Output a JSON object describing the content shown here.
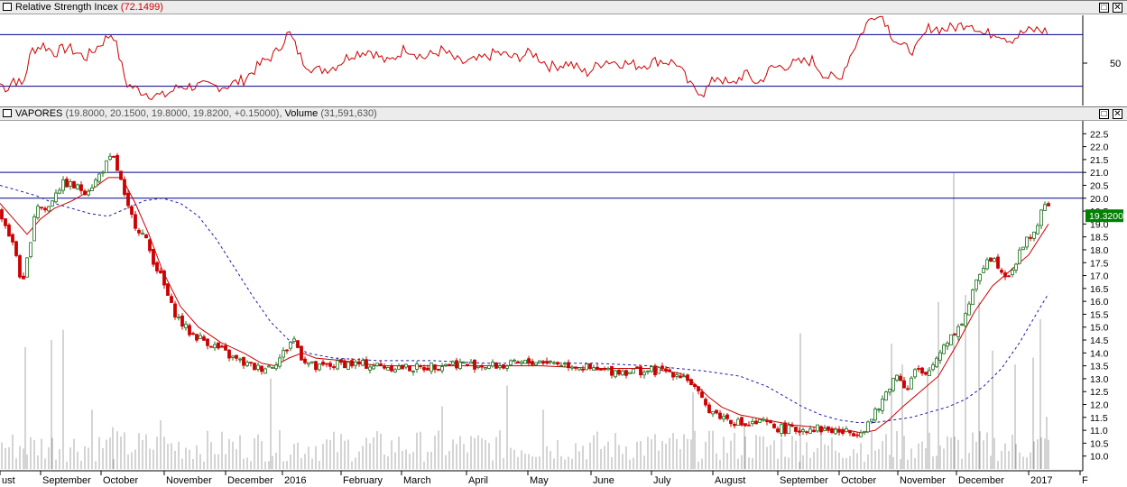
{
  "rsi_panel": {
    "title": "Relative Strength Incex",
    "value": "(72.1499)",
    "axis_label": "50",
    "buttons": [
      "□",
      "✕"
    ]
  },
  "price_panel": {
    "title": "VAPORES",
    "ohlc_text": "(19.8000, 20.1500, 19.8000, 19.8200, +0.15000),",
    "volume_title": "Volume",
    "volume_value": "(31,591,630)",
    "last_price": "19.3200",
    "buttons": [
      "□",
      "✕"
    ]
  },
  "colors": {
    "candle_up": "#1a6e1a",
    "candle_down": "#cc0000",
    "sma_short": "#cc0000",
    "sma_long": "#1a1aa8",
    "hline": "#00008b",
    "last_price_bg": "#008000"
  },
  "chart_data": [
    {
      "type": "line",
      "title": "Relative Strength Incex",
      "ylim": [
        15,
        85
      ],
      "hlines": [
        30,
        70
      ],
      "yticks": [
        "50"
      ],
      "series": [
        {
          "name": "Relative Strength Incex",
          "x": [
            0,
            8,
            15,
            25,
            35,
            48,
            60,
            75,
            95,
            110,
            125,
            140,
            150,
            165,
            180,
            200,
            215,
            230,
            250,
            270,
            290,
            305,
            320,
            335,
            350,
            370,
            390,
            410,
            430,
            450,
            470,
            490,
            510,
            530,
            550,
            570,
            590,
            610,
            630,
            650,
            670,
            690,
            710,
            730,
            750,
            765,
            780,
            795,
            810,
            825,
            840,
            855,
            870,
            885,
            900,
            915,
            930,
            945,
            960,
            975,
            988,
            1000,
            1015,
            1030,
            1045,
            1060,
            1075,
            1090,
            1105,
            1120,
            1135,
            1150,
            1162
          ],
          "values": [
            32,
            28,
            36,
            30,
            58,
            62,
            56,
            60,
            52,
            62,
            72,
            32,
            28,
            24,
            22,
            30,
            30,
            30,
            30,
            35,
            48,
            55,
            72,
            50,
            42,
            45,
            55,
            58,
            48,
            60,
            52,
            58,
            48,
            50,
            56,
            52,
            56,
            45,
            48,
            40,
            50,
            48,
            46,
            50,
            48,
            30,
            25,
            38,
            30,
            40,
            32,
            44,
            46,
            48,
            50,
            38,
            35,
            58,
            78,
            90,
            70,
            60,
            58,
            76,
            74,
            76,
            80,
            70,
            72,
            66,
            72,
            74,
            72
          ]
        }
      ]
    },
    {
      "type": "candlestick",
      "title": "VAPORES",
      "ylim": [
        9.5,
        23.0
      ],
      "yticks": [
        "10.0",
        "10.5",
        "11.0",
        "11.5",
        "12.0",
        "12.5",
        "13.0",
        "13.5",
        "14.0",
        "14.5",
        "15.0",
        "15.5",
        "16.0",
        "16.5",
        "17.0",
        "17.5",
        "18.0",
        "18.5",
        "19.0",
        "19.5",
        "20.0",
        "20.5",
        "21.0",
        "21.5",
        "22.0",
        "22.5"
      ],
      "hlines": [
        21.0,
        20.0
      ],
      "xticks": [
        "ust",
        "September",
        "October",
        "November",
        "December",
        "2016",
        "February",
        "March",
        "April",
        "May",
        "June",
        "July",
        "August",
        "September",
        "October",
        "November",
        "December",
        "2017",
        "F"
      ],
      "x_range": [
        0,
        1200
      ],
      "xtick_positions": [
        0,
        45,
        112,
        182,
        250,
        313,
        378,
        445,
        517,
        585,
        655,
        722,
        790,
        862,
        930,
        995,
        1060,
        1140,
        1197
      ],
      "close_anchors": {
        "x": [
          0,
          10,
          18,
          25,
          32,
          40,
          52,
          62,
          72,
          85,
          95,
          105,
          115,
          125,
          133,
          140,
          150,
          160,
          170,
          180,
          190,
          200,
          210,
          220,
          232,
          245,
          258,
          270,
          285,
          300,
          310,
          318,
          325,
          335,
          350,
          380,
          420,
          460,
          500,
          540,
          560,
          600,
          640,
          660,
          700,
          740,
          760,
          770,
          780,
          795,
          810,
          825,
          845,
          860,
          880,
          900,
          920,
          940,
          955,
          965,
          975,
          985,
          995,
          1005,
          1015,
          1025,
          1035,
          1045,
          1055,
          1065,
          1075,
          1085,
          1095,
          1105,
          1115,
          1125,
          1135,
          1145,
          1155,
          1162
        ],
        "values": [
          19.5,
          18.6,
          17.8,
          16.5,
          18.0,
          19.8,
          19.5,
          20.3,
          20.6,
          20.4,
          20.3,
          20.6,
          21.2,
          21.6,
          20.8,
          19.7,
          19.0,
          18.5,
          17.6,
          16.8,
          15.8,
          15.2,
          14.8,
          14.6,
          14.4,
          14.1,
          13.8,
          13.6,
          13.4,
          13.5,
          13.8,
          14.2,
          14.6,
          13.8,
          13.4,
          13.6,
          13.5,
          13.4,
          13.6,
          13.5,
          13.5,
          13.7,
          13.5,
          13.3,
          13.3,
          13.3,
          13.1,
          12.6,
          12.0,
          11.6,
          11.4,
          11.2,
          11.3,
          11.1,
          11.0,
          11.1,
          11.0,
          10.9,
          11.0,
          11.4,
          11.9,
          12.7,
          13.2,
          12.6,
          13.4,
          13.0,
          13.6,
          14.3,
          14.7,
          15.1,
          16.0,
          17.0,
          17.8,
          17.5,
          17.0,
          17.4,
          18.3,
          18.6,
          19.5,
          19.8
        ]
      },
      "sma_short": {
        "name": "sma-short",
        "x": [
          0,
          15,
          30,
          45,
          60,
          80,
          100,
          120,
          135,
          150,
          165,
          180,
          200,
          220,
          245,
          270,
          290,
          305,
          320,
          335,
          350,
          380,
          420,
          480,
          540,
          600,
          660,
          720,
          755,
          770,
          785,
          800,
          820,
          850,
          880,
          910,
          940,
          955,
          970,
          985,
          1000,
          1020,
          1040,
          1060,
          1080,
          1100,
          1120,
          1140,
          1162
        ],
        "values": [
          19.8,
          19.2,
          18.6,
          19.2,
          19.6,
          19.9,
          20.3,
          20.8,
          20.8,
          19.8,
          18.6,
          17.2,
          15.8,
          15.0,
          14.4,
          14.0,
          13.6,
          13.5,
          13.8,
          14.0,
          13.8,
          13.7,
          13.5,
          13.5,
          13.5,
          13.5,
          13.4,
          13.4,
          13.2,
          12.8,
          12.3,
          11.9,
          11.6,
          11.4,
          11.2,
          11.1,
          11.0,
          10.9,
          11.0,
          11.4,
          11.9,
          12.5,
          13.1,
          14.3,
          15.6,
          16.6,
          17.2,
          17.8,
          19.0
        ]
      },
      "sma_long": {
        "name": "sma-long",
        "x": [
          0,
          20,
          40,
          60,
          80,
          100,
          120,
          140,
          160,
          180,
          200,
          220,
          240,
          260,
          280,
          300,
          320,
          340,
          370,
          420,
          480,
          540,
          600,
          660,
          720,
          780,
          820,
          850,
          870,
          890,
          910,
          930,
          950,
          970,
          990,
          1010,
          1030,
          1050,
          1070,
          1090,
          1110,
          1130,
          1150,
          1162
        ],
        "values": [
          20.5,
          20.3,
          20.1,
          19.8,
          19.6,
          19.4,
          19.3,
          19.6,
          19.9,
          20.0,
          19.8,
          19.3,
          18.4,
          17.3,
          16.2,
          15.2,
          14.5,
          14.0,
          13.8,
          13.7,
          13.7,
          13.6,
          13.6,
          13.6,
          13.5,
          13.3,
          13.1,
          12.7,
          12.3,
          11.9,
          11.6,
          11.4,
          11.3,
          11.3,
          11.4,
          11.5,
          11.7,
          11.9,
          12.2,
          12.7,
          13.4,
          14.4,
          15.6,
          16.3
        ]
      },
      "volume_spikes": {
        "x": [
          28,
          57,
          70,
          102,
          125,
          178,
          300,
          490,
          562,
          602,
          768,
          825,
          887,
          988,
          1000,
          1028,
          1040,
          1057,
          1070,
          1085,
          1100,
          1125,
          1145,
          1153,
          1160
        ],
        "heights": [
          0.35,
          0.37,
          0.4,
          0.17,
          0.12,
          0.14,
          0.26,
          0.18,
          0.24,
          0.17,
          0.22,
          0.13,
          0.39,
          0.36,
          0.3,
          0.29,
          0.48,
          0.85,
          0.5,
          0.48,
          0.34,
          0.3,
          0.32,
          0.43,
          0.15
        ]
      }
    }
  ]
}
